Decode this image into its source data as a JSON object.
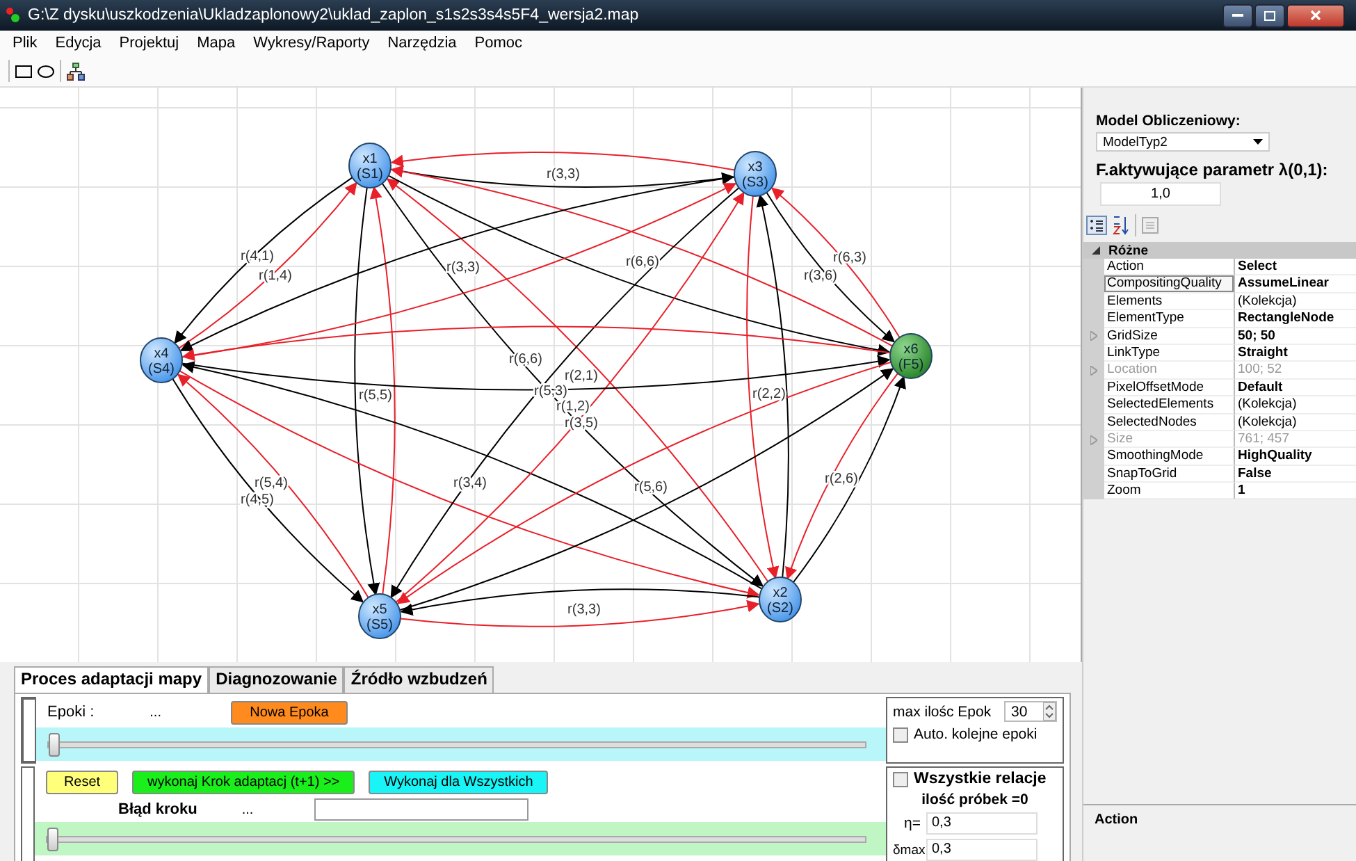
{
  "window": {
    "title": "G:\\Z dysku\\uszkodzenia\\Ukladzaplonowy2\\uklad_zaplon_s1s2s3s4s5F4_wersja2.map"
  },
  "menu": [
    "Plik",
    "Edycja",
    "Projektuj",
    "Mapa",
    "Wykresy/Raporty",
    "Narzędzia",
    "Pomoc"
  ],
  "diagram": {
    "nodes": [
      {
        "label": "x1",
        "sublabel": "(S1)",
        "kind": "state"
      },
      {
        "label": "x2",
        "sublabel": "(S2)",
        "kind": "state"
      },
      {
        "label": "x3",
        "sublabel": "(S3)",
        "kind": "state"
      },
      {
        "label": "x4",
        "sublabel": "(S4)",
        "kind": "state"
      },
      {
        "label": "x5",
        "sublabel": "(S5)",
        "kind": "state"
      },
      {
        "label": "x6",
        "sublabel": "(F5)",
        "kind": "fault"
      }
    ],
    "edge_labels": [
      "r(4,1)",
      "r(1,4)",
      "r(3,3)",
      "r(3,3)",
      "r(6,6)",
      "r(6,3)",
      "r(3,6)",
      "r(6,6)",
      "r(5,5)",
      "r(2,1)",
      "r(5,3)",
      "r(1,2)",
      "r(3,5)",
      "r(2,2)",
      "r(5,4)",
      "r(4,5)",
      "r(3,4)",
      "r(5,6)",
      "r(2,6)",
      "r(3,3)"
    ]
  },
  "side_panel": {
    "model_label": "Model Obliczeniowy:",
    "model_value": "ModelTyp2",
    "param_label": "F.aktywujące parametr λ(0,1):",
    "param_value": "1,0",
    "category": "Różne",
    "properties": [
      {
        "name": "Action",
        "value": "Select",
        "modified": true,
        "expandable": false,
        "readonly": false,
        "hovered": false
      },
      {
        "name": "CompositingQuality",
        "value": "AssumeLinear",
        "modified": true,
        "expandable": false,
        "readonly": false,
        "hovered": true
      },
      {
        "name": "Elements",
        "value": "(Kolekcja)",
        "modified": false,
        "expandable": false,
        "readonly": false,
        "hovered": false
      },
      {
        "name": "ElementType",
        "value": "RectangleNode",
        "modified": true,
        "expandable": false,
        "readonly": false,
        "hovered": false
      },
      {
        "name": "GridSize",
        "value": "50; 50",
        "modified": true,
        "expandable": true,
        "readonly": false,
        "hovered": false
      },
      {
        "name": "LinkType",
        "value": "Straight",
        "modified": true,
        "expandable": false,
        "readonly": false,
        "hovered": false
      },
      {
        "name": "Location",
        "value": "100; 52",
        "modified": false,
        "expandable": true,
        "readonly": true,
        "hovered": false
      },
      {
        "name": "PixelOffsetMode",
        "value": "Default",
        "modified": true,
        "expandable": false,
        "readonly": false,
        "hovered": false
      },
      {
        "name": "SelectedElements",
        "value": "(Kolekcja)",
        "modified": false,
        "expandable": false,
        "readonly": false,
        "hovered": false
      },
      {
        "name": "SelectedNodes",
        "value": "(Kolekcja)",
        "modified": false,
        "expandable": false,
        "readonly": false,
        "hovered": false
      },
      {
        "name": "Size",
        "value": "761; 457",
        "modified": false,
        "expandable": true,
        "readonly": true,
        "hovered": false
      },
      {
        "name": "SmoothingMode",
        "value": "HighQuality",
        "modified": true,
        "expandable": false,
        "readonly": false,
        "hovered": false
      },
      {
        "name": "SnapToGrid",
        "value": "False",
        "modified": true,
        "expandable": false,
        "readonly": false,
        "hovered": false
      },
      {
        "name": "Zoom",
        "value": "1",
        "modified": true,
        "expandable": false,
        "readonly": false,
        "hovered": false
      }
    ],
    "description_title": "Action"
  },
  "tabs": [
    {
      "label": "Proces adaptacji mapy",
      "selected": true
    },
    {
      "label": "Diagnozowanie",
      "selected": false
    },
    {
      "label": "Źródło  wzbudzeń",
      "selected": false
    }
  ],
  "epochs": {
    "label": "Epoki :",
    "value": "...",
    "button": "Nowa Epoka",
    "level": 0,
    "max_label": "max ilośc Epok",
    "max_value": "30",
    "auto_label": "Auto. kolejne epoki",
    "auto_checked": false
  },
  "step": {
    "reset": "Reset",
    "step_button": "wykonaj Krok adaptacj (t+1) >>",
    "all_button": "Wykonaj dla Wszystkich",
    "error_label": "Błąd kroku",
    "error_value": "...",
    "level": 0,
    "all_relations_label": "Wszystkie relacje",
    "all_relations_checked": false,
    "samples": "ilość próbek =0",
    "eta_label": "η=",
    "eta_value": "0,3",
    "delta_label": "δmax",
    "delta_value": "0,3"
  }
}
